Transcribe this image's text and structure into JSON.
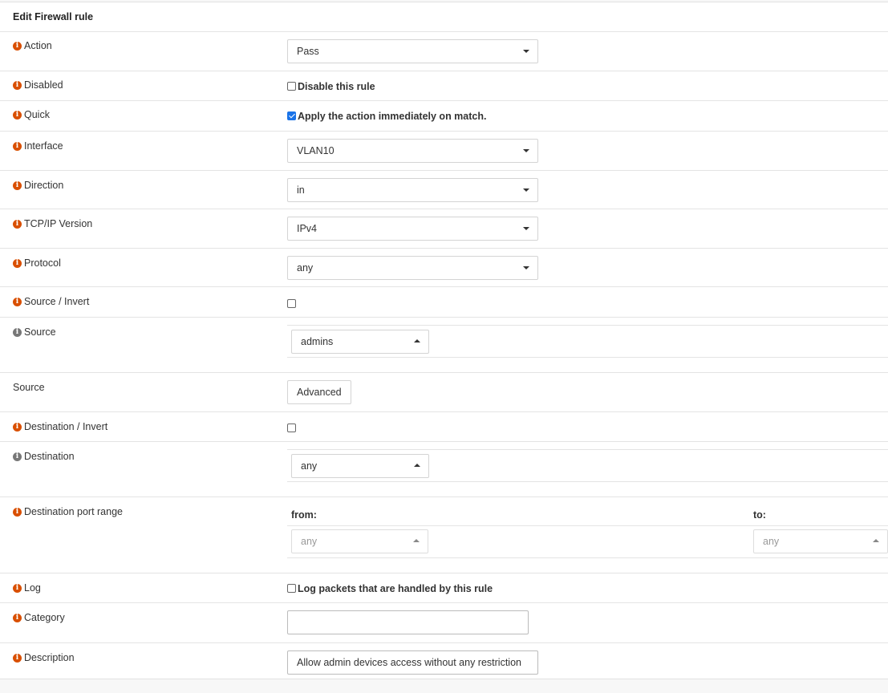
{
  "title": "Edit Firewall rule",
  "action": {
    "label": "Action",
    "value": "Pass"
  },
  "disabled": {
    "label": "Disabled",
    "checkbox_label": "Disable this rule",
    "checked": false
  },
  "quick": {
    "label": "Quick",
    "checkbox_label": "Apply the action immediately on match.",
    "checked": true
  },
  "interface": {
    "label": "Interface",
    "value": "VLAN10"
  },
  "direction": {
    "label": "Direction",
    "value": "in"
  },
  "ipversion": {
    "label": "TCP/IP Version",
    "value": "IPv4"
  },
  "protocol": {
    "label": "Protocol",
    "value": "any"
  },
  "source_invert": {
    "label": "Source / Invert",
    "checked": false
  },
  "source": {
    "label": "Source",
    "value": "admins"
  },
  "source_advanced": {
    "label": "Source",
    "button": "Advanced"
  },
  "destination_invert": {
    "label": "Destination / Invert",
    "checked": false
  },
  "destination": {
    "label": "Destination",
    "value": "any"
  },
  "dest_port_range": {
    "label": "Destination port range",
    "from_label": "from:",
    "to_label": "to:",
    "from_value": "any",
    "to_value": "any"
  },
  "log": {
    "label": "Log",
    "checkbox_label": "Log packets that are handled by this rule",
    "checked": false
  },
  "category": {
    "label": "Category",
    "value": ""
  },
  "description": {
    "label": "Description",
    "value": "Allow admin devices access without any restriction"
  },
  "icons": {
    "info": "info-icon"
  },
  "colors": {
    "info_icon": "#d94f00",
    "info_icon_grey": "#777777",
    "checkbox_checked": "#1a73e8"
  }
}
